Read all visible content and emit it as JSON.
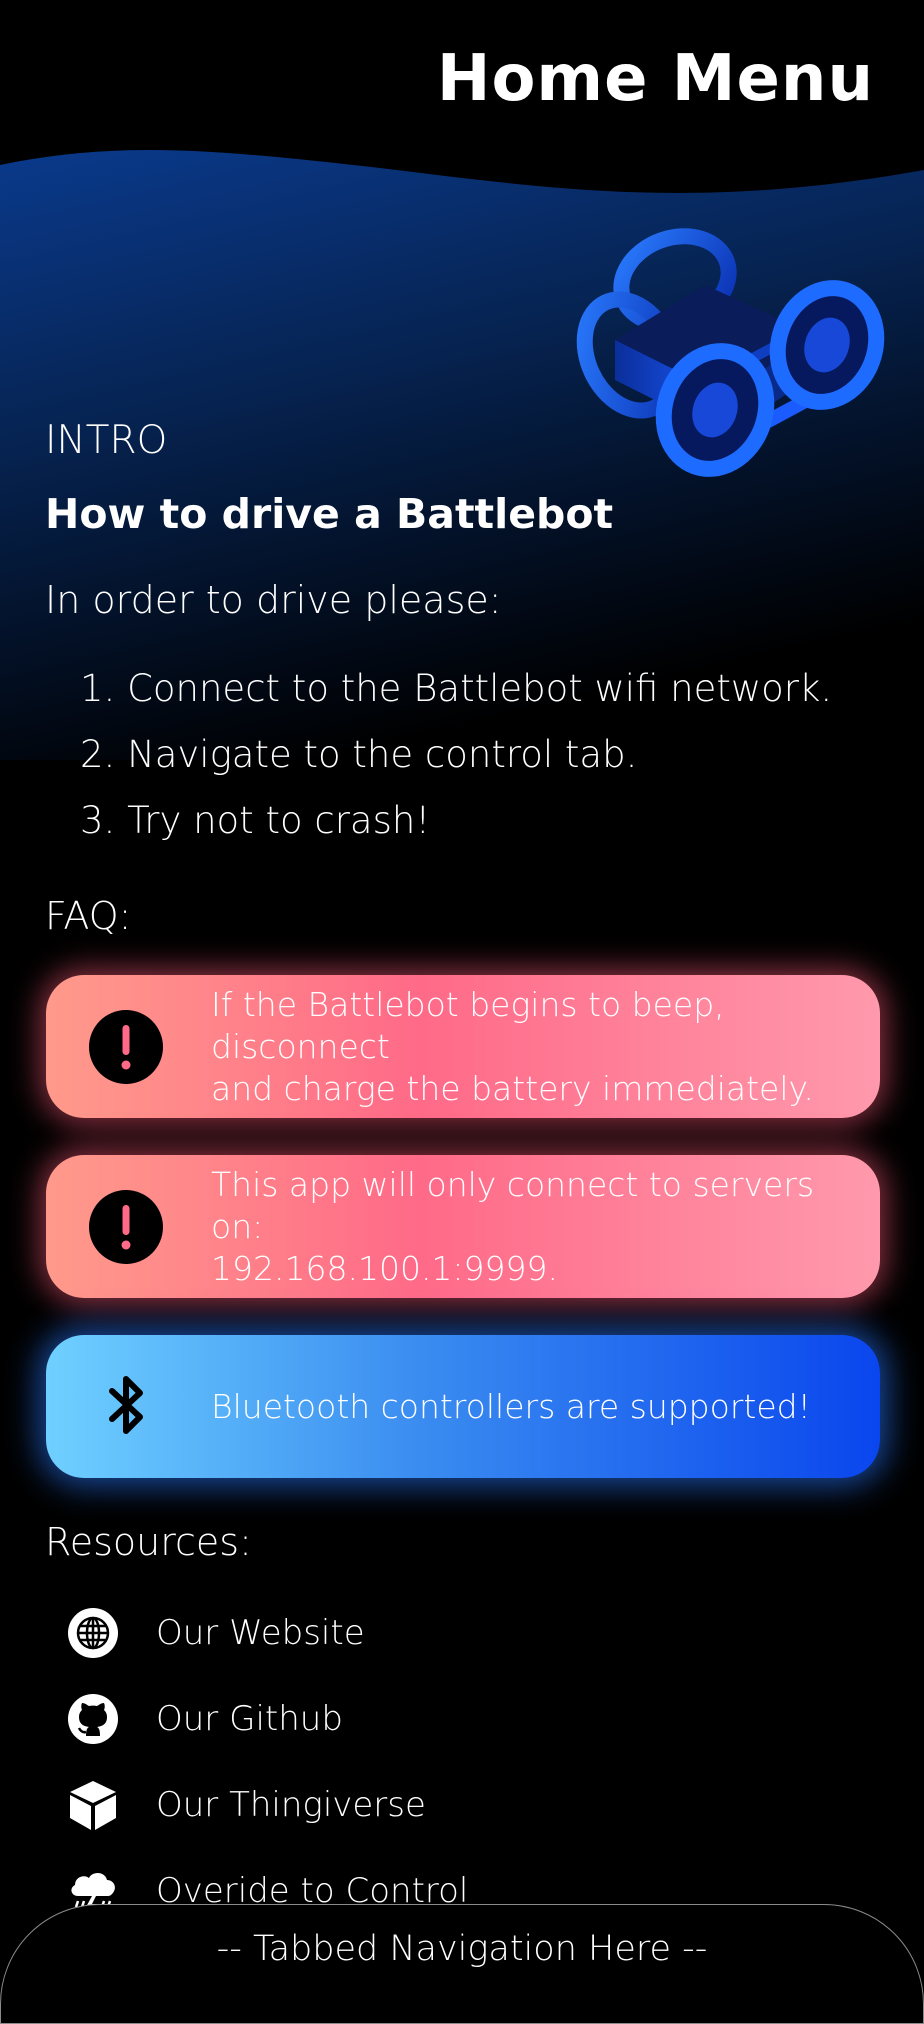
{
  "header": {
    "title": "Home Menu"
  },
  "intro": {
    "section_label": "INTRO",
    "title": "How to drive a Battlebot",
    "lead": "In order to drive please:",
    "steps": [
      "1. Connect to the Battlebot wifi network.",
      "2. Navigate to the control tab.",
      "3. Try not to crash!"
    ]
  },
  "faq": {
    "section_label": "FAQ:",
    "cards": [
      {
        "icon": "exclamation-icon",
        "line1": "If the Battlebot begins to beep, disconnect",
        "line2": "and charge the battery immediately."
      },
      {
        "icon": "exclamation-icon",
        "line1": "This app will only connect to servers on:",
        "line2": "192.168.100.1:9999."
      },
      {
        "icon": "bluetooth-icon",
        "line1": "Bluetooth controllers are supported!"
      }
    ]
  },
  "resources": {
    "section_label": "Resources:",
    "items": [
      {
        "icon": "globe-icon",
        "label": "Our Website"
      },
      {
        "icon": "github-icon",
        "label": "Our Github"
      },
      {
        "icon": "cube-icon",
        "label": "Our Thingiverse"
      },
      {
        "icon": "storm-cloud-icon",
        "label": "Overide to Control"
      }
    ]
  },
  "tabbar": {
    "label": "-- Tabbed Navigation Here --"
  },
  "colors": {
    "background": "#000000",
    "warn_gradient": [
      "#ff9a8b",
      "#ff6a88",
      "#ff99ac"
    ],
    "info_gradient": [
      "#6fd0ff",
      "#3a8cf0",
      "#0a46ee"
    ],
    "header_wave": "#0a3a8a"
  }
}
